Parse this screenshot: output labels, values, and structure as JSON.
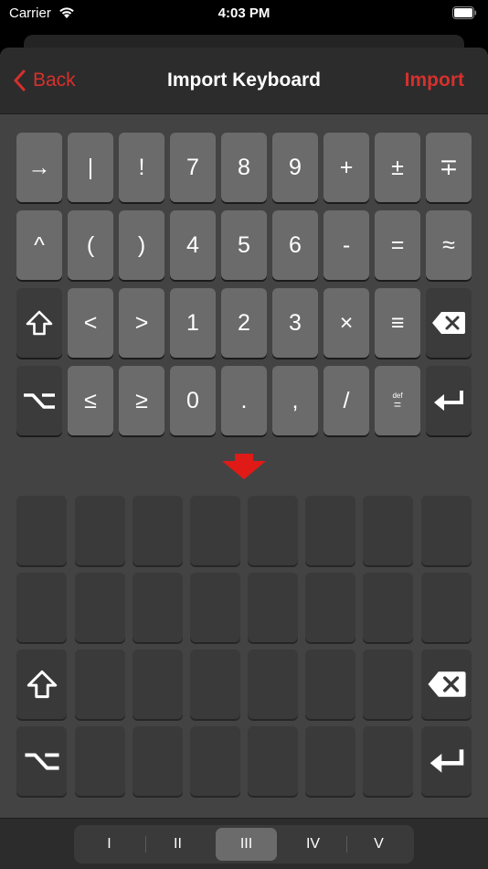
{
  "status_bar": {
    "carrier": "Carrier",
    "time": "4:03 PM"
  },
  "nav": {
    "back_label": "Back",
    "title": "Import Keyboard",
    "import_label": "Import"
  },
  "keyboard": {
    "rows": [
      [
        "→",
        "|",
        "!",
        "7",
        "8",
        "9",
        "+",
        "±",
        "∓"
      ],
      [
        "^",
        "(",
        ")",
        "4",
        "5",
        "6",
        "-",
        "=",
        "≈"
      ],
      [
        "shift-icon",
        "<",
        ">",
        "1",
        "2",
        "3",
        "×",
        "≡",
        "backspace-icon"
      ],
      [
        "option-icon",
        "≤",
        "≥",
        "0",
        ".",
        ",",
        "/",
        "def",
        "return-icon"
      ]
    ],
    "def_key": {
      "top": "def",
      "mid": "="
    }
  },
  "target_keyboard": {
    "icons": [
      "shift-icon",
      "backspace-icon",
      "option-icon",
      "return-icon"
    ]
  },
  "tabs": {
    "items": [
      "I",
      "II",
      "III",
      "IV",
      "V"
    ],
    "selected": "III"
  },
  "colors": {
    "accent": "#d7302c",
    "key": "#6b6b6b",
    "slot": "#3a3a3a",
    "background": "#434343"
  }
}
